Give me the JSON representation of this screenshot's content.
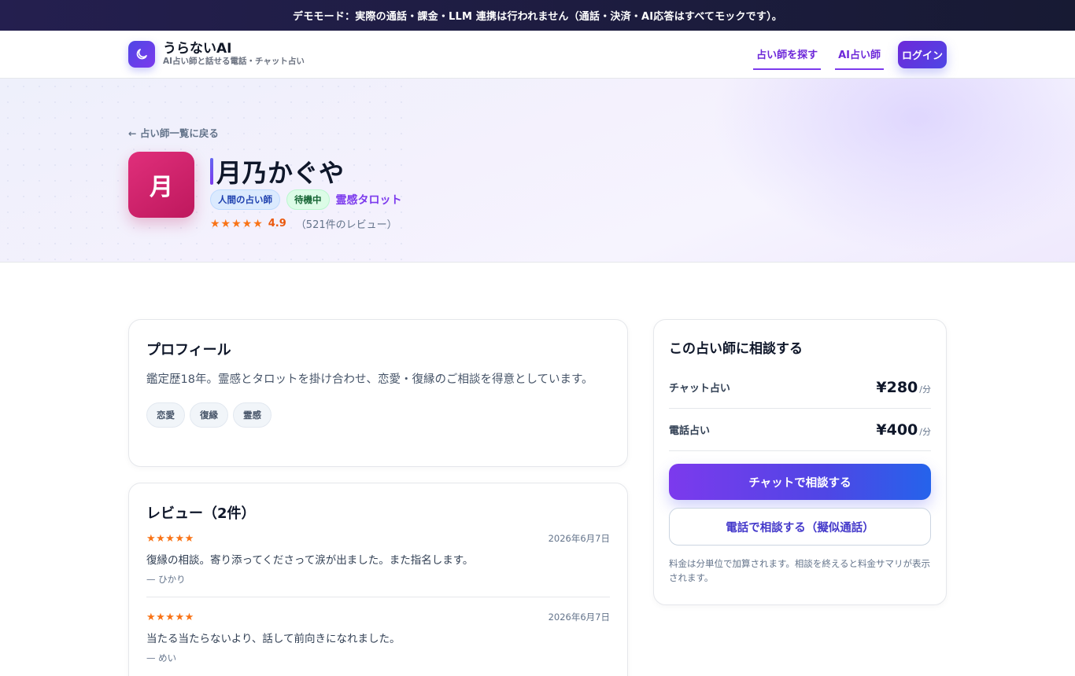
{
  "banner": {
    "text": "デモモード：実際の通話・課金・LLM 連携は行われません（通話・決済・AI応答はすべてモックです）。"
  },
  "header": {
    "brand_name": "うらないAI",
    "brand_tagline": "AI占い師と話せる電話・チャット占い",
    "nav": {
      "find": "占い師を探す",
      "ai": "AI占い師",
      "login": "ログイン"
    }
  },
  "hero": {
    "back_link": "← 占い師一覧に戻る",
    "avatar_char": "月",
    "name": "月乃かぐや",
    "badge_type": "人間の占い師",
    "badge_status": "待機中",
    "specialty": "霊感タロット",
    "stars": "★★★★★",
    "rating": "4.9",
    "review_count": "（521件のレビュー）"
  },
  "profile": {
    "title": "プロフィール",
    "text": "鑑定歴18年。霊感とタロットを掛け合わせ、恋愛・復縁のご相談を得意としています。",
    "tags": [
      "恋愛",
      "復縁",
      "霊感"
    ]
  },
  "reviews": {
    "title": "レビュー（2件）",
    "items": [
      {
        "stars": "★★★★★",
        "date": "2026年6月7日",
        "body": "復縁の相談。寄り添ってくださって涙が出ました。また指名します。",
        "author": "— ひかり"
      },
      {
        "stars": "★★★★★",
        "date": "2026年6月7日",
        "body": "当たる当たらないより、話して前向きになれました。",
        "author": "— めい"
      }
    ]
  },
  "consult": {
    "title": "この占い師に相談する",
    "chat_label": "チャット占い",
    "chat_price": "¥280",
    "phone_label": "電話占い",
    "phone_price": "¥400",
    "unit": "/分",
    "chat_button": "チャットで相談する",
    "phone_button": "電話で相談する（擬似通話）",
    "note": "料金は分単位で加算されます。相談を終えると料金サマリが表示されます。"
  },
  "colors": {
    "accent": "#7c3aed",
    "star": "#f97316",
    "avatar": "#be185d"
  },
  "icons": {
    "brand": "moon-icon"
  }
}
